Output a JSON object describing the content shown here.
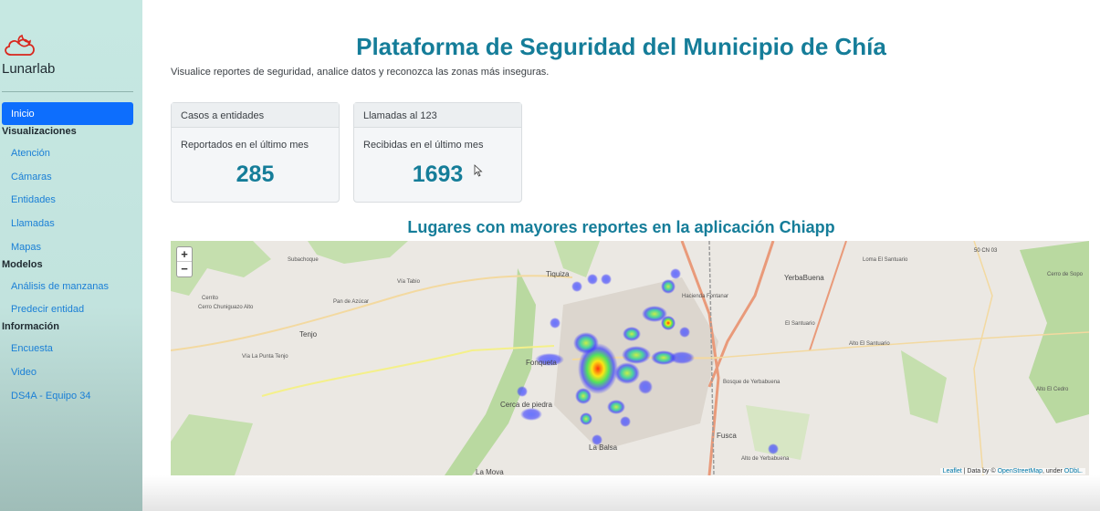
{
  "sidebar": {
    "brand": "Lunarlab",
    "active_item": "Inicio",
    "sections": [
      {
        "label": "Visualizaciones",
        "items": [
          "Atención",
          "Cámaras",
          "Entidades",
          "Llamadas",
          "Mapas"
        ]
      },
      {
        "label": "Modelos",
        "items": [
          "Análisis de manzanas",
          "Predecir entidad"
        ]
      },
      {
        "label": "Información",
        "items": [
          "Encuesta",
          "Video",
          "DS4A - Equipo 34"
        ]
      }
    ]
  },
  "header": {
    "title": "Plataforma de Seguridad del Municipio de Chía",
    "subtitle": "Visualice reportes de seguridad, analice datos y reconozca las zonas más inseguras."
  },
  "cards": [
    {
      "header": "Casos a entidades",
      "text": "Reportados en el último mes",
      "value": "285"
    },
    {
      "header": "Llamadas al 123",
      "text": "Recibidas en el último mes",
      "value": "1693"
    }
  ],
  "map": {
    "title": "Lugares con mayores reportes en la aplicación Chiapp",
    "zoom_in": "+",
    "zoom_out": "−",
    "labels": [
      "Tiquiza",
      "Tenjo",
      "Fonqueta",
      "Cerca de piedra",
      "La Balsa",
      "La Mova",
      "Fusca",
      "YerbaBuena",
      "El Santuario",
      "Alto El Santuario",
      "Cerrito",
      "Pan de Azúcar",
      "Hacienda Fontanar",
      "50 CN 03",
      "Vía La Punta Tenjo",
      "Vía Tabio",
      "Bosque de Yerbabuena",
      "Alto de Yerbabuena",
      "Cerro Chuniguazo Alto",
      "Subachoque",
      "Loma El Santuario",
      "Cerro de Sopo",
      "Alto El Cedro"
    ],
    "attribution_leaflet": "Leaflet",
    "attribution_data": " | Data by © ",
    "attribution_osm": "OpenStreetMap",
    "attribution_under": ", under ",
    "attribution_odbl": "ODbL."
  },
  "colors": {
    "accent": "#157d99",
    "primary": "#0d6efd",
    "sidebar_bg": "#c6e8e2",
    "logo": "#d9261c"
  }
}
